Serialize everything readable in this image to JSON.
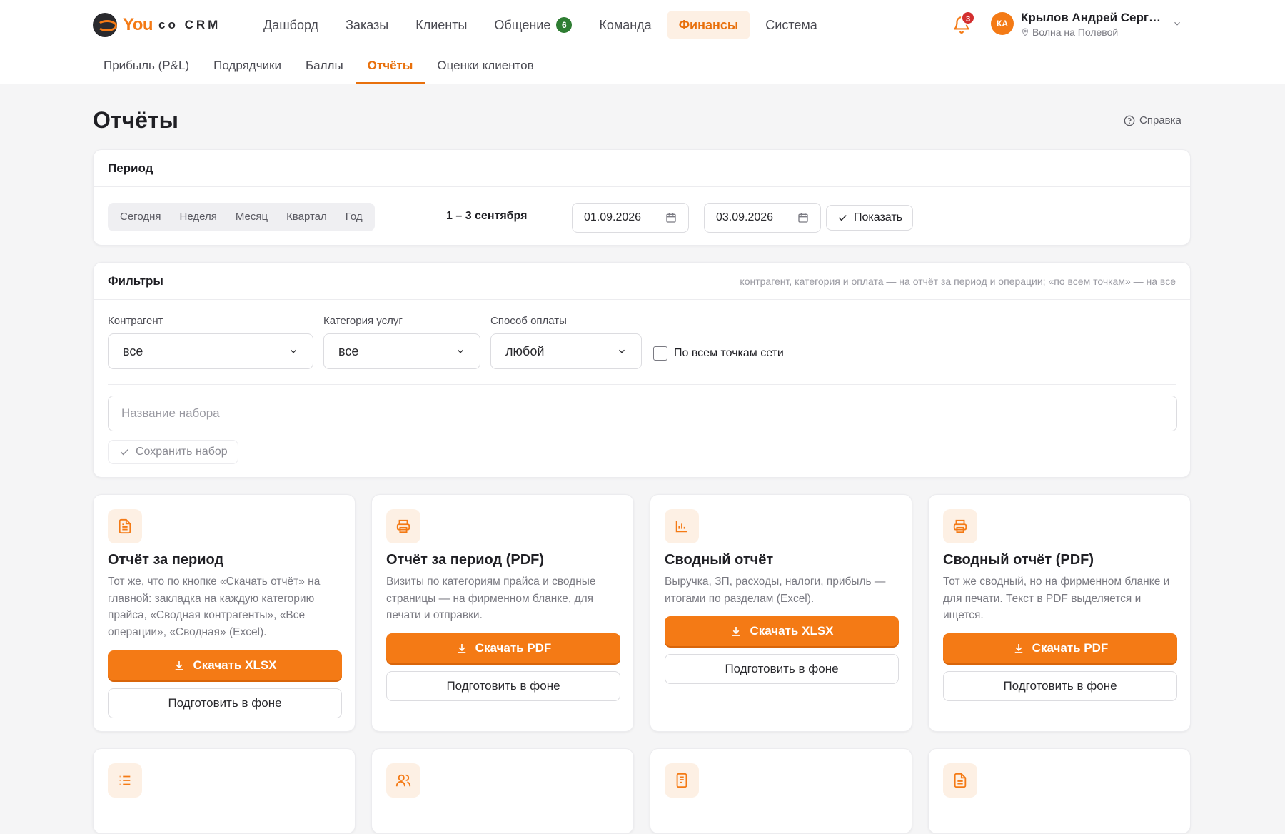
{
  "brand": {
    "you": "You",
    "rest": "co CRM"
  },
  "nav": {
    "items": [
      {
        "label": "Дашборд"
      },
      {
        "label": "Заказы"
      },
      {
        "label": "Клиенты"
      },
      {
        "label": "Общение",
        "badge": "6"
      },
      {
        "label": "Команда"
      },
      {
        "label": "Финансы",
        "active": true
      },
      {
        "label": "Система"
      }
    ]
  },
  "notifications": {
    "count": "3"
  },
  "user": {
    "initials": "КА",
    "name": "Крылов Андрей Сергее...",
    "location": "Волна на Полевой"
  },
  "subnav": {
    "items": [
      {
        "label": "Прибыль (P&L)"
      },
      {
        "label": "Подрядчики"
      },
      {
        "label": "Баллы"
      },
      {
        "label": "Отчёты",
        "active": true
      },
      {
        "label": "Оценки клиентов"
      }
    ]
  },
  "page": {
    "title": "Отчёты",
    "help": "Справка"
  },
  "period": {
    "title": "Период",
    "presets": [
      "Сегодня",
      "Неделя",
      "Месяц",
      "Квартал",
      "Год"
    ],
    "range_text": "1 – 3 сентября",
    "date_from": "01.09.2026",
    "date_to": "03.09.2026",
    "separator": "–",
    "show_label": "Показать"
  },
  "filters": {
    "title": "Фильтры",
    "hint": "контрагент, категория и оплата — на отчёт за период и операции; «по всем точкам» — на все",
    "counterparty_label": "Контрагент",
    "counterparty_value": "все",
    "category_label": "Категория услуг",
    "category_value": "все",
    "payment_label": "Способ оплаты",
    "payment_value": "любой",
    "all_points_label": "По всем точкам сети",
    "set_name_placeholder": "Название набора",
    "save_set_label": "Сохранить набор"
  },
  "reports": [
    {
      "title": "Отчёт за период",
      "desc": "Тот же, что по кнопке «Скачать отчёт» на главной: закладка на каждую категорию прайса, «Сводная контрагенты», «Все операции», «Сводная» (Excel).",
      "primary": "Скачать XLSX",
      "secondary": "Подготовить в фоне",
      "icon": "document-icon"
    },
    {
      "title": "Отчёт за период (PDF)",
      "desc": "Визиты по категориям прайса и сводные страницы — на фирменном бланке, для печати и отправки.",
      "primary": "Скачать PDF",
      "secondary": "Подготовить в фоне",
      "icon": "printer-icon"
    },
    {
      "title": "Сводный отчёт",
      "desc": "Выручка, ЗП, расходы, налоги, прибыль — итогами по разделам (Excel).",
      "primary": "Скачать XLSX",
      "secondary": "Подготовить в фоне",
      "icon": "bar-chart-icon"
    },
    {
      "title": "Сводный отчёт (PDF)",
      "desc": "Тот же сводный, но на фирменном бланке и для печати. Текст в PDF выделяется и ищется.",
      "primary": "Скачать PDF",
      "secondary": "Подготовить в фоне",
      "icon": "printer-icon"
    }
  ],
  "reports_row2_icons": [
    "list-icon",
    "users-icon",
    "receipt-icon",
    "document-icon"
  ],
  "colors": {
    "accent": "#f47a15",
    "accent_soft": "#fdf0e4",
    "badge_green": "#2e7d32",
    "badge_red": "#d32f2f"
  }
}
